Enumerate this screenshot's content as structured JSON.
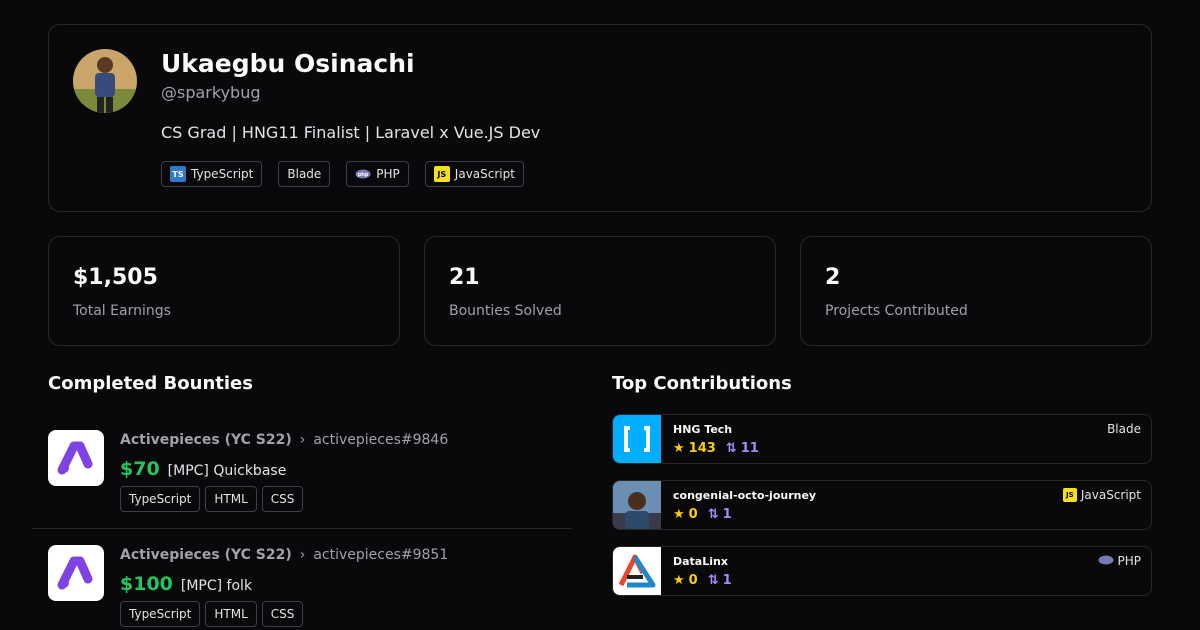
{
  "profile": {
    "name": "Ukaegbu Osinachi",
    "handle": "@sparkybug",
    "bio": "CS Grad | HNG11 Finalist | Laravel x Vue.JS Dev",
    "languages": [
      {
        "label": "TypeScript",
        "icon": "typescript-icon"
      },
      {
        "label": "Blade",
        "icon": ""
      },
      {
        "label": "PHP",
        "icon": "php-icon"
      },
      {
        "label": "JavaScript",
        "icon": "javascript-icon"
      }
    ]
  },
  "stats": [
    {
      "value": "$1,505",
      "label": "Total Earnings"
    },
    {
      "value": "21",
      "label": "Bounties Solved"
    },
    {
      "value": "2",
      "label": "Projects Contributed"
    }
  ],
  "bounties_section": {
    "title": "Completed Bounties",
    "items": [
      {
        "org": "Activepieces (YC S22)",
        "issue": "activepieces#9846",
        "amount": "$70",
        "title": "[MPC] Quickbase",
        "tags": [
          "TypeScript",
          "HTML",
          "CSS"
        ]
      },
      {
        "org": "Activepieces (YC S22)",
        "issue": "activepieces#9851",
        "amount": "$100",
        "title": "[MPC] folk",
        "tags": [
          "TypeScript",
          "HTML",
          "CSS"
        ]
      }
    ]
  },
  "contributions_section": {
    "title": "Top Contributions",
    "items": [
      {
        "name": "HNG Tech",
        "stars": "143",
        "prs": "11",
        "language": "Blade"
      },
      {
        "name": "congenial-octo-journey",
        "stars": "0",
        "prs": "1",
        "language": "JavaScript"
      },
      {
        "name": "DataLinx",
        "stars": "0",
        "prs": "1",
        "language": "PHP"
      }
    ]
  },
  "colors": {
    "background": "#09090b",
    "border": "#27272a",
    "amount": "#22c55e",
    "star": "#facc15",
    "pr": "#a78bfa",
    "activepieces": "#8142e3"
  }
}
